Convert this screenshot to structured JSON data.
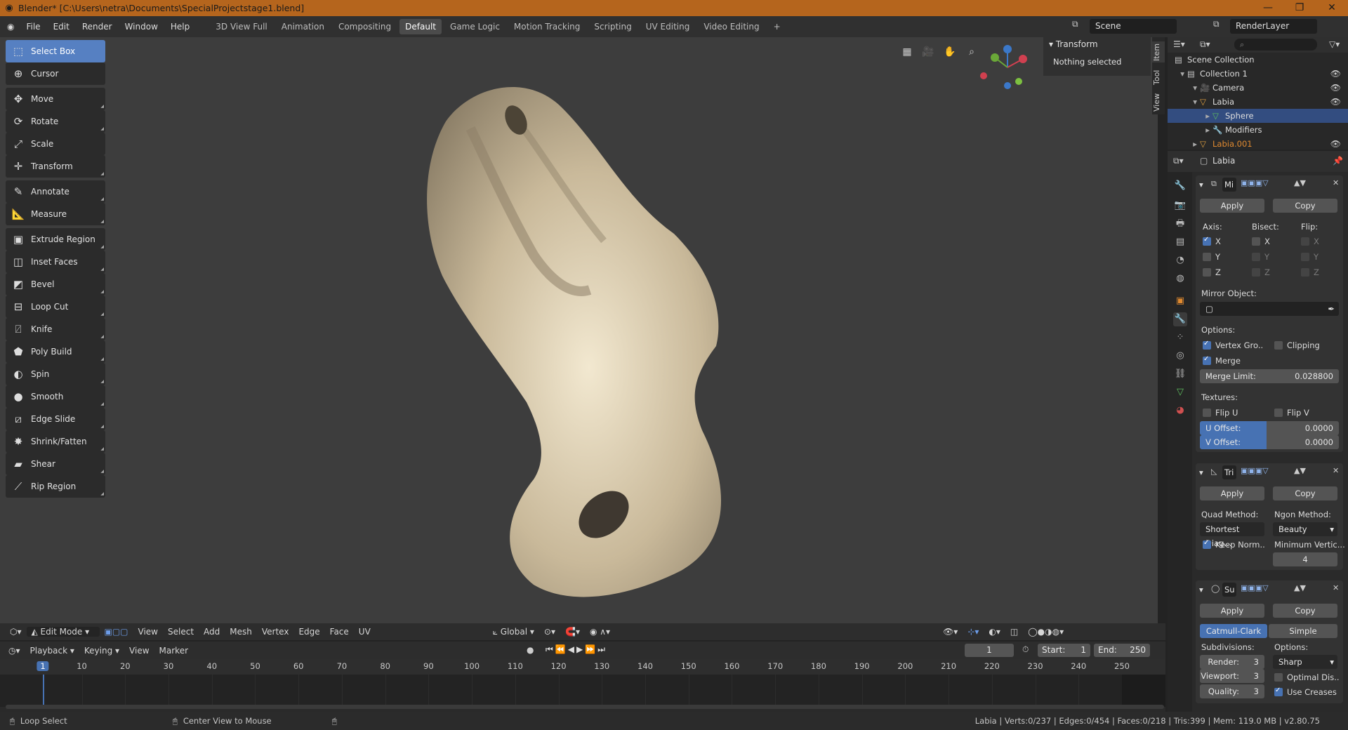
{
  "title_bar": {
    "title": "Blender* [C:\\Users\\netra\\Documents\\SpecialProjectstage1.blend]"
  },
  "menu": [
    "File",
    "Edit",
    "Render",
    "Window",
    "Help"
  ],
  "workspaces": [
    "3D View Full",
    "Animation",
    "Compositing",
    "Default",
    "Game Logic",
    "Motion Tracking",
    "Scripting",
    "UV Editing",
    "Video Editing"
  ],
  "active_workspace": "Default",
  "scene_name": "Scene",
  "view_layer": "RenderLayer",
  "tools": [
    {
      "label": "Select Box",
      "icon": "select-box-icon",
      "glyph": "⬚"
    },
    {
      "label": "Cursor",
      "icon": "cursor-icon",
      "glyph": "⊕"
    },
    {
      "label": "Move",
      "icon": "move-icon",
      "glyph": "✥"
    },
    {
      "label": "Rotate",
      "icon": "rotate-icon",
      "glyph": "⟳"
    },
    {
      "label": "Scale",
      "icon": "scale-icon",
      "glyph": "⤢"
    },
    {
      "label": "Transform",
      "icon": "transform-icon",
      "glyph": "✛"
    },
    {
      "label": "Annotate",
      "icon": "annotate-icon",
      "glyph": "✎"
    },
    {
      "label": "Measure",
      "icon": "measure-icon",
      "glyph": "📐"
    },
    {
      "label": "Extrude Region",
      "icon": "extrude-region-icon",
      "glyph": "▣"
    },
    {
      "label": "Inset Faces",
      "icon": "inset-faces-icon",
      "glyph": "◫"
    },
    {
      "label": "Bevel",
      "icon": "bevel-icon",
      "glyph": "◩"
    },
    {
      "label": "Loop Cut",
      "icon": "loop-cut-icon",
      "glyph": "⊟"
    },
    {
      "label": "Knife",
      "icon": "knife-icon",
      "glyph": "⍁"
    },
    {
      "label": "Poly Build",
      "icon": "poly-build-icon",
      "glyph": "⬟"
    },
    {
      "label": "Spin",
      "icon": "spin-icon",
      "glyph": "◐"
    },
    {
      "label": "Smooth",
      "icon": "smooth-icon",
      "glyph": "●"
    },
    {
      "label": "Edge Slide",
      "icon": "edge-slide-icon",
      "glyph": "⧄"
    },
    {
      "label": "Shrink/Fatten",
      "icon": "shrink-fatten-icon",
      "glyph": "✸"
    },
    {
      "label": "Shear",
      "icon": "shear-icon",
      "glyph": "▰"
    },
    {
      "label": "Rip Region",
      "icon": "rip-region-icon",
      "glyph": "⟋"
    }
  ],
  "npanel": {
    "header": "Transform",
    "message": "Nothing selected",
    "tabs": [
      "Item",
      "Tool",
      "View"
    ]
  },
  "viewport_header": {
    "mode": "Edit Mode",
    "menus": [
      "View",
      "Select",
      "Add",
      "Mesh",
      "Vertex",
      "Edge",
      "Face",
      "UV"
    ],
    "orientation": "Global"
  },
  "timeline": {
    "menus": [
      "Playback",
      "Keying",
      "View",
      "Marker"
    ],
    "current_frame": "1",
    "start_label": "Start:",
    "start": "1",
    "end_label": "End:",
    "end": "250",
    "ticks": [
      "1",
      "10",
      "20",
      "30",
      "40",
      "50",
      "60",
      "70",
      "80",
      "90",
      "100",
      "110",
      "120",
      "130",
      "140",
      "150",
      "160",
      "170",
      "180",
      "190",
      "200",
      "210",
      "220",
      "230",
      "240",
      "250"
    ]
  },
  "status": {
    "left": "Loop Select",
    "middle": "Center View to Mouse",
    "right": "Labia | Verts:0/237 | Edges:0/454 | Faces:0/218 | Tris:399 | Mem: 119.0 MB | v2.80.75"
  },
  "outliner": {
    "rows": [
      {
        "label": "Scene Collection",
        "indent": 0
      },
      {
        "label": "Collection 1",
        "indent": 1
      },
      {
        "label": "Camera",
        "indent": 2
      },
      {
        "label": "Labia",
        "indent": 2
      },
      {
        "label": "Sphere",
        "indent": 3
      },
      {
        "label": "Modifiers",
        "indent": 3
      },
      {
        "label": "Labia.001",
        "indent": 2
      }
    ]
  },
  "properties": {
    "object_name": "Labia",
    "mirror": {
      "name": "Mi",
      "apply": "Apply",
      "copy": "Copy",
      "axis_label": "Axis:",
      "bisect_label": "Bisect:",
      "flip_label": "Flip:",
      "axes": [
        "X",
        "Y",
        "Z"
      ],
      "mirror_object_label": "Mirror Object:",
      "options_label": "Options:",
      "vertex_groups": "Vertex Gro..",
      "clipping": "Clipping",
      "merge": "Merge",
      "merge_limit_label": "Merge Limit:",
      "merge_limit": "0.028800",
      "textures_label": "Textures:",
      "flip_u": "Flip U",
      "flip_v": "Flip V",
      "u_offset_label": "U Offset:",
      "u_offset": "0.0000",
      "v_offset_label": "V Offset:",
      "v_offset": "0.0000"
    },
    "triangulate": {
      "name": "Tri",
      "apply": "Apply",
      "copy": "Copy",
      "quad_method_label": "Quad Method:",
      "quad_method": "Shortest Diag...",
      "ngon_method_label": "Ngon Method:",
      "ngon_method": "Beauty",
      "keep_normals": "Keep Norm..",
      "min_vertices_label": "Minimum Vertic...",
      "min_vertices": "4"
    },
    "subsurf": {
      "name": "Su",
      "apply": "Apply",
      "copy": "Copy",
      "catmull": "Catmull-Clark",
      "simple": "Simple",
      "subdivisions_label": "Subdivisions:",
      "options_label": "Options:",
      "render_label": "Render:",
      "render": "3",
      "viewport_label": "Viewport:",
      "viewport": "3",
      "quality_label": "Quality:",
      "quality": "3",
      "uv_smooth": "Sharp",
      "optimal_display": "Optimal Dis..",
      "use_creases": "Use Creases"
    }
  }
}
